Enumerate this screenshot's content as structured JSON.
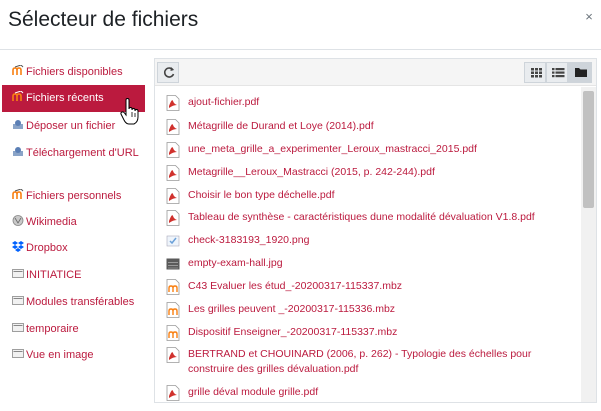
{
  "dialog": {
    "title": "Sélecteur de fichiers",
    "close_label": "×"
  },
  "sidebar": {
    "items": [
      {
        "label": "Fichiers disponibles",
        "icon": "moodle-icon",
        "active": false
      },
      {
        "label": "Fichiers récents",
        "icon": "moodle-icon",
        "active": true
      },
      {
        "label": "Déposer un fichier",
        "icon": "upload-icon",
        "active": false
      },
      {
        "label": "Téléchargement d'URL",
        "icon": "url-icon",
        "active": false
      },
      {
        "label": "Fichiers personnels",
        "icon": "moodle-icon",
        "active": false
      },
      {
        "label": "Wikimedia",
        "icon": "wikimedia-icon",
        "active": false
      },
      {
        "label": "Dropbox",
        "icon": "dropbox-icon",
        "active": false
      },
      {
        "label": "INITIATICE",
        "icon": "folder-icon",
        "active": false
      },
      {
        "label": "Modules transférables",
        "icon": "folder-icon",
        "active": false
      },
      {
        "label": "temporaire",
        "icon": "folder-icon",
        "active": false
      },
      {
        "label": "Vue en image",
        "icon": "folder-icon",
        "active": false
      }
    ]
  },
  "toolbar": {
    "refresh_icon": "refresh-icon",
    "view_icons": "grid-icon",
    "view_list": "list-icon",
    "view_tree": "folder-icon",
    "active_view": "tree"
  },
  "files": [
    {
      "name": "ajout-fichier.pdf",
      "type": "pdf"
    },
    {
      "name": "Métagrille de Durand et Loye (2014).pdf",
      "type": "pdf"
    },
    {
      "name": "une_meta_grille_a_experimenter_Leroux_mastracci_2015.pdf",
      "type": "pdf"
    },
    {
      "name": "Metagrille__Leroux_Mastracci (2015, p. 242-244).pdf",
      "type": "pdf"
    },
    {
      "name": "Choisir le bon type déchelle.pdf",
      "type": "pdf"
    },
    {
      "name": "Tableau de synthèse - caractéristiques dune modalité dévaluation V1.8.pdf",
      "type": "pdf"
    },
    {
      "name": "check-3183193_1920.png",
      "type": "png"
    },
    {
      "name": "empty-exam-hall.jpg",
      "type": "jpg"
    },
    {
      "name": "C43 Evaluer les étud_-20200317-115337.mbz",
      "type": "mbz"
    },
    {
      "name": "Les grilles peuvent _-20200317-115336.mbz",
      "type": "mbz"
    },
    {
      "name": "Dispositif Enseigner_-20200317-115337.mbz",
      "type": "mbz"
    },
    {
      "name": "BERTRAND et CHOUINARD (2006, p. 262) - Typologie des échelles pour construire des grilles dévaluation.pdf",
      "type": "pdf"
    },
    {
      "name": "grille déval module grille.pdf",
      "type": "pdf"
    }
  ],
  "colors": {
    "accent": "#bb1a3e",
    "pdf_red": "#d0312d",
    "moodle_orange": "#f98012"
  }
}
